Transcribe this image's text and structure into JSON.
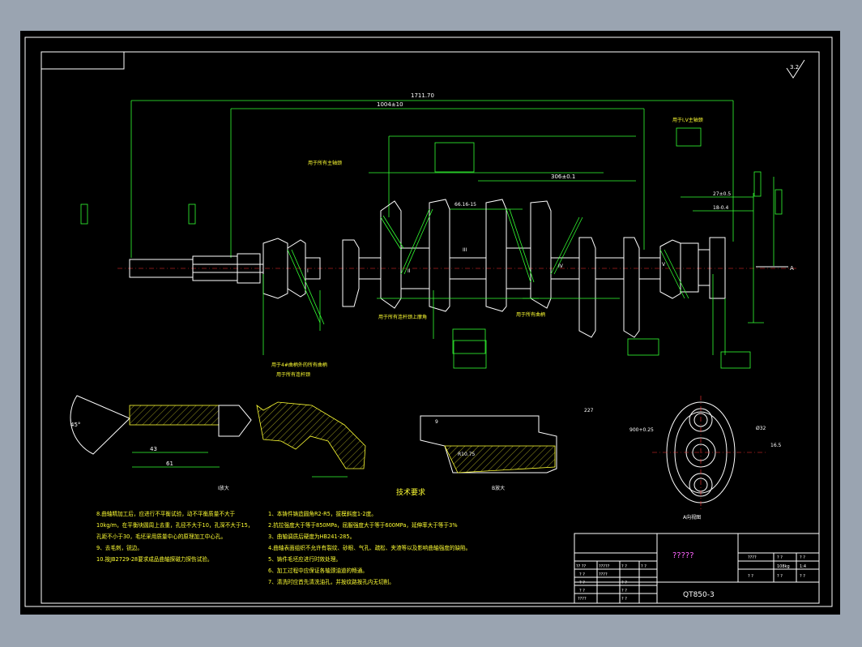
{
  "dimensions": {
    "overall_length": "1711.70",
    "len_1004": "1004±10",
    "len_306": "306±0.1",
    "dim_66": "66.16-15",
    "dim_43": "43",
    "dim_61": "61",
    "dim_45": "45°",
    "dim_227": "227",
    "dim_9": "9",
    "dim_r_small": "R10.75",
    "dim_900": "900+0.25",
    "dim_phi32": "Ø32",
    "dim_16_5": "16.5",
    "dim_27": "27±0.5",
    "dim_18": "18-0.4"
  },
  "notes": {
    "for_main_journals": "用于所有主轴颈",
    "for_crank_pins": "用于所有曲柄",
    "for_rod_journals": "用于所有连杆颈上摩角",
    "for_main_1_v": "用于I,V主轴颈",
    "for_front_cranks": "用于4#曲柄外的所有曲柄",
    "section_a": "A向视图",
    "section_b": "B放大",
    "section_i": "I放大",
    "section_top_note": "用于所有连杆颈"
  },
  "section_label_A": "A",
  "roman": [
    "I",
    "II",
    "III",
    "IV",
    "V"
  ],
  "tech_title": "技术要求",
  "tech_left": [
    "8.曲轴精加工后，应进行不平衡试验，动不平衡质量不大于",
    "10kg/m，在平衡块圆周上去重，孔径不大于10，孔深不大于15，",
    "孔距不小于30，毛坯采用质量中心的原理加工中心孔。",
    "9、去毛刺，锐边。",
    "10.按JB2729-28要求成品曲轴探磁力探伤试验。"
  ],
  "tech_right": [
    "1、本铸件铸造圆角R2-R5，拔模斜度1-2度。",
    "2.抗拉强度大于等于850MPa，屈服强度大于等于600MPa，延伸率大于等于3%",
    "3、曲轴调质后硬度为HB241-285。",
    "4.曲轴表面组织不允许有裂纹、砂眼、气孔、疏松、夹渣等以及影响曲轴强度的缺陷。",
    "5、铸件毛坯应进行时效处理。",
    "6、加工过程中应保证各轴颈油道的畅通。",
    "7、清洗时应首先清洗油孔，并按纹路按孔内无切削。"
  ],
  "title_block": {
    "name": "?????",
    "material": "QT850-3",
    "mass": "108kg",
    "scale": "1:4",
    "tbl_top_a": "????",
    "tbl_top_b": "? ?",
    "tbl_top_c": "? ?",
    "tbl_row_a": "? ?",
    "tbl_row_b": "? ?",
    "tbl_row_c": "? ?",
    "left_r1_a": "?? ??",
    "left_r1_b": "?????",
    "left_r1_c": "? ?",
    "left_r1_d": "? ?",
    "left_r2_a": "? ?",
    "left_r2_b": "????",
    "left_r3_a": "? ?",
    "left_r3_b": "? ?",
    "left_r4_a": "? ?",
    "left_r4_b": "? ?",
    "left_r5_a": "????",
    "left_r5_b": "? ?"
  },
  "roughness_top": "3.2"
}
